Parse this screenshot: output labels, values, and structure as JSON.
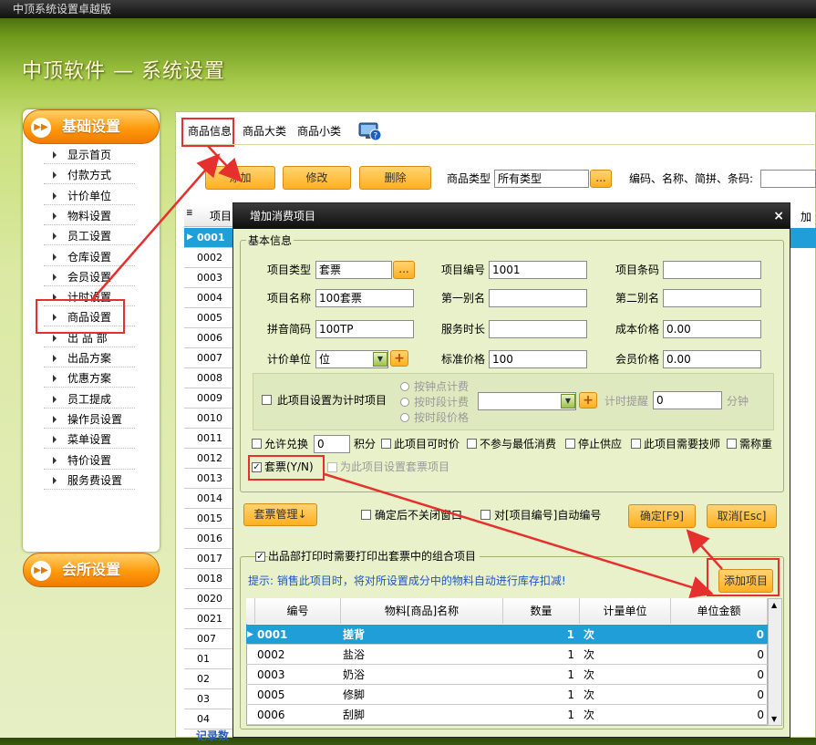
{
  "window": {
    "title": "中顶系统设置卓越版"
  },
  "app_title": "中顶软件 — 系统设置",
  "left_panel": {
    "section1": "基础设置",
    "items": [
      "显示首页",
      "付款方式",
      "计价单位",
      "物料设置",
      "员工设置",
      "仓库设置",
      "会员设置",
      "计时设置",
      "商品设置",
      "出 品 部",
      "出品方案",
      "优惠方案",
      "员工提成",
      "操作员设置",
      "菜单设置",
      "特价设置",
      "服务费设置"
    ],
    "section2": "会所设置"
  },
  "main": {
    "tabs": [
      "商品信息",
      "商品大类",
      "商品小类"
    ],
    "buttons": {
      "add": "添加",
      "edit": "修改",
      "delete": "删除"
    },
    "type_label": "商品类型",
    "type_value": "所有类型",
    "dots": "...",
    "search_label": "编码、名称、简拼、条码:",
    "grid_header_left": "项目",
    "grid_header_right": "加工",
    "grid_codes": [
      "0001",
      "0002",
      "0003",
      "0004",
      "0005",
      "0006",
      "0007",
      "0008",
      "0009",
      "0010",
      "0011",
      "0012",
      "0013",
      "0014",
      "0015",
      "0016",
      "0017",
      "0018",
      "0020",
      "0021",
      "007",
      "01",
      "02",
      "03",
      "04"
    ],
    "footer_text": "记录数"
  },
  "dialog": {
    "title": "增加消费项目",
    "close": "×",
    "group1": "基本信息",
    "fields": {
      "type_label": "项目类型",
      "type_value": "套票",
      "code_label": "项目编号",
      "code_value": "1001",
      "barcode_label": "项目条码",
      "barcode_value": "",
      "name_label": "项目名称",
      "name_value": "100套票",
      "alias1_label": "第一别名",
      "alias1_value": "",
      "alias2_label": "第二别名",
      "alias2_value": "",
      "pinyin_label": "拼音简码",
      "pinyin_value": "100TP",
      "service_label": "服务时长",
      "service_value": "",
      "cost_label": "成本价格",
      "cost_value": "0.00",
      "unit_label": "计价单位",
      "unit_value": "位",
      "std_price_label": "标准价格",
      "std_price_value": "100",
      "member_price_label": "会员价格",
      "member_price_value": "0.00"
    },
    "timing": {
      "checkbox": "此项目设置为计时项目",
      "radio1": "按钟点计费",
      "radio2": "按时段计费",
      "radio3": "按时段价格",
      "remind_label": "计时提醒",
      "remind_value": "0",
      "minutes": "分钟"
    },
    "options": [
      "允许兑换",
      "积分",
      "此项目可时价",
      "不参与最低消费",
      "停止供应",
      "此项目需要技师",
      "需称重"
    ],
    "points_value": "0",
    "ticket_checkbox": "套票(Y/N)",
    "ticket_sub": "为此项目设置套票项目",
    "ticket_manage": "套票管理↓",
    "no_close": "确定后不关闭窗口",
    "auto_code": "对[项目编号]自动编号",
    "ok": "确定[F9]",
    "cancel": "取消[Esc]",
    "print_group": "出品部打印时需要打印出套票中的组合项目",
    "hint": "提示: 销售此项目时，将对所设置成分中的物料自动进行库存扣减!",
    "add_item": "添加项目",
    "table": {
      "columns": [
        "编号",
        "物料[商品]名称",
        "数量",
        "计量单位",
        "单位金额"
      ],
      "rows": [
        {
          "code": "0001",
          "name": "搓背",
          "qty": "1",
          "unit": "次",
          "price": "0"
        },
        {
          "code": "0002",
          "name": "盐浴",
          "qty": "1",
          "unit": "次",
          "price": "0"
        },
        {
          "code": "0003",
          "name": "奶浴",
          "qty": "1",
          "unit": "次",
          "price": "0"
        },
        {
          "code": "0005",
          "name": "修脚",
          "qty": "1",
          "unit": "次",
          "price": "0"
        },
        {
          "code": "0006",
          "name": "刮脚",
          "qty": "1",
          "unit": "次",
          "price": "0"
        }
      ]
    }
  },
  "colors": {
    "accent_orange": "#ff9a0c",
    "highlight_blue": "#1f9ed8",
    "annotation_red": "#e6302d"
  }
}
